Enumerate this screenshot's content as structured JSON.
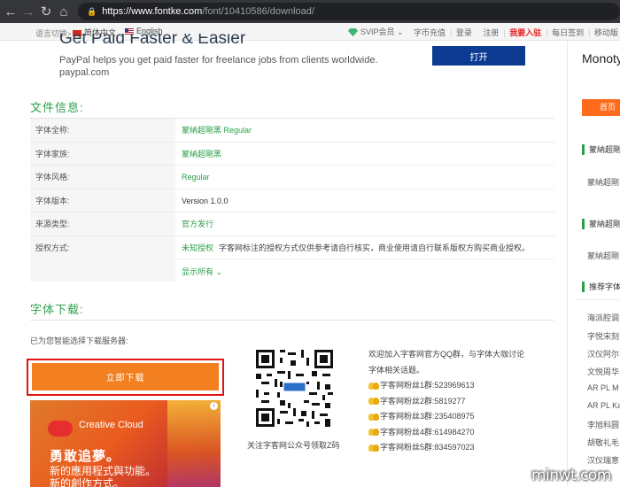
{
  "browser": {
    "url_host": "https://www.fontke.com",
    "url_path": "/font/10410586/download/",
    "back_icon": "arrow-left-icon",
    "forward_icon": "arrow-right-icon",
    "refresh_icon": "refresh-icon",
    "home_icon": "home-icon",
    "lock_icon": "lock-icon"
  },
  "topbar": {
    "lang_label": "语言切换:",
    "lang_cn": "简体中文",
    "lang_en": "English",
    "svip": "SVIP会员 ⌄",
    "links": [
      "字币充值",
      "登录",
      "注册",
      "我要入驻",
      "每日签到",
      "移动版"
    ]
  },
  "ad": {
    "title": "Get Paid Faster & Easier",
    "desc": "PayPal helps you get paid faster for freelance jobs from clients worldwide.",
    "host": "paypal.com",
    "button": "打开"
  },
  "sidebar": {
    "title": "Monoty",
    "home": "首页",
    "head1": "蒙納超剛",
    "item1": "蒙納超剛",
    "head2": "蒙納超剛",
    "item2": "蒙納超剛",
    "head3": "推荐字体",
    "items": [
      "海派腔调",
      "字悦宋刻",
      "汉仪阿尔",
      "文悦周华",
      "AR PL M",
      "AR PL Ka",
      "李旭科圆",
      "胡敬礼毛",
      "汉仪瑞意"
    ]
  },
  "info": {
    "section_title": "文件信息:",
    "rows": [
      {
        "label": "字体全称:",
        "value": "蒙納超剛黑 Regular"
      },
      {
        "label": "字体家族:",
        "value": "蒙納超剛黑"
      },
      {
        "label": "字体风格:",
        "value": "Regular"
      },
      {
        "label": "字体版本:",
        "value": "Version 1.0.0"
      },
      {
        "label": "来源类型:",
        "value": "官方发行"
      },
      {
        "label": "授权方式:",
        "value": "未知授权",
        "note": "字客网标注的授权方式仅供参考请自行核实，商业使用请自行联系版权方购买商业授权。"
      }
    ],
    "show_all": "显示所有 ⌄"
  },
  "download": {
    "section_title": "字体下载:",
    "auto_select": "已为您智能选择下载服务器:",
    "button": "立即下载"
  },
  "adobe": {
    "brand": "Creative Cloud",
    "headline": "勇敢追夢。",
    "line1": "新的應用程式與功能。",
    "line2": "新的創作方式。",
    "adchoice": "i"
  },
  "qr": {
    "caption": "关注字客网公众号领取Z码"
  },
  "qq": {
    "intro": "欢迎加入字客网官方QQ群，与字体大咖讨论字体相关话题。",
    "groups": [
      "字客网粉丝1群:523969613",
      "字客网粉丝2群:5819277",
      "字客网粉丝3群:235408975",
      "字客网粉丝4群:614984270",
      "字客网粉丝5群:834597023"
    ]
  },
  "watermark": "minwt.com"
}
